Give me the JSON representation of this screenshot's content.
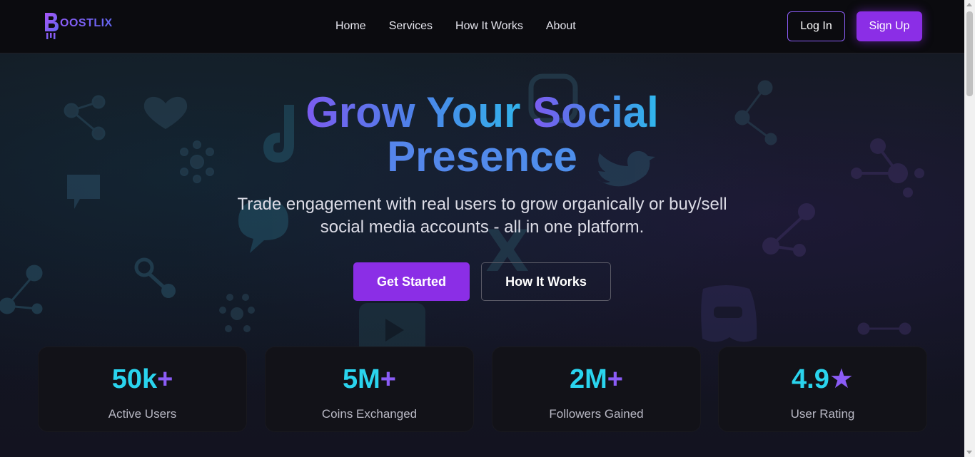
{
  "brand": {
    "name": "OOSTLIX",
    "logo_icon": "b-rocket-logo-icon"
  },
  "nav": {
    "links": [
      "Home",
      "Services",
      "How It Works",
      "About"
    ],
    "login_label": "Log In",
    "signup_label": "Sign Up"
  },
  "hero": {
    "title_line1_a": "Grow Your ",
    "title_line1_b": "Social",
    "title_line2": "Presence",
    "subtitle_line1": "Trade engagement with real users to grow organically or buy/sell",
    "subtitle_line2": "social media accounts - all in one platform.",
    "primary_cta": "Get Started",
    "secondary_cta": "How It Works"
  },
  "stats": [
    {
      "value": "50k",
      "suffix": "+",
      "label": "Active Users"
    },
    {
      "value": "5M",
      "suffix": "+",
      "label": "Coins Exchanged"
    },
    {
      "value": "2M",
      "suffix": "+",
      "label": "Followers Gained"
    },
    {
      "value": "4.9",
      "suffix": "★",
      "label": "User Rating"
    }
  ],
  "colors": {
    "accent": "#8b2ee6",
    "stat_number": "#2ad4ee",
    "stat_suffix": "#8b5cf6",
    "background": "#0f0f14"
  },
  "background_icons": [
    "heart-icon",
    "instagram-icon",
    "tiktok-icon",
    "twitter-icon",
    "chat-bubble-icon",
    "x-logo-icon",
    "youtube-icon",
    "discord-icon",
    "network-icon"
  ]
}
